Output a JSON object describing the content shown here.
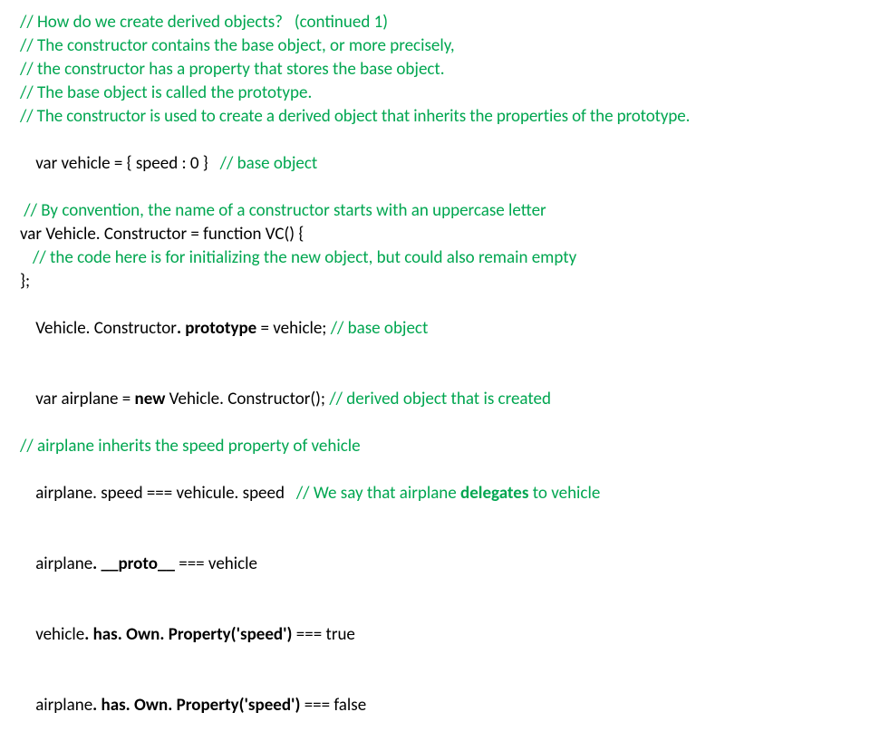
{
  "lines": {
    "l01": "// How do we create derived objects?   (continued 1)",
    "l02": "// The constructor contains the base object, or more precisely,",
    "l03": "// the constructor has a property that stores the base object.",
    "l04": "// The base object is called the prototype.",
    "l05": "// The constructor is used to create a derived object that inherits the properties of the prototype.",
    "l06a": "var vehicle = { speed : 0 }   ",
    "l06b": "// base object",
    "l07": " // By convention, the name of a constructor starts with an uppercase letter",
    "l08": "var Vehicle. Constructor = function VC() {",
    "l09": "// the code here is for initializing the new object, but could also remain empty",
    "l10": "};",
    "l11a": "Vehicle. Constructor",
    "l11b": ". prototype",
    "l11c": " = vehicle; ",
    "l11d": "// base object",
    "l12a": "var airplane = ",
    "l12b": "new ",
    "l12c": "Vehicle. Constructor(); ",
    "l12d": "// derived object that is created",
    "l13": "// airplane inherits the speed property of vehicle",
    "l14a": "airplane. speed === vehicule. speed   ",
    "l14b": "// We say that airplane ",
    "l14c": "delegates ",
    "l14d": "to vehicle",
    "l15a": "airplane",
    "l15b": ". __proto__ ",
    "l15c": "=== vehicle",
    "l16a": "vehicle",
    "l16b": ". has. Own. Property('speed') ",
    "l16c": "=== true",
    "l17a": "airplane",
    "l17b": ". has. Own. Property('speed') ",
    "l17c": "=== false"
  }
}
